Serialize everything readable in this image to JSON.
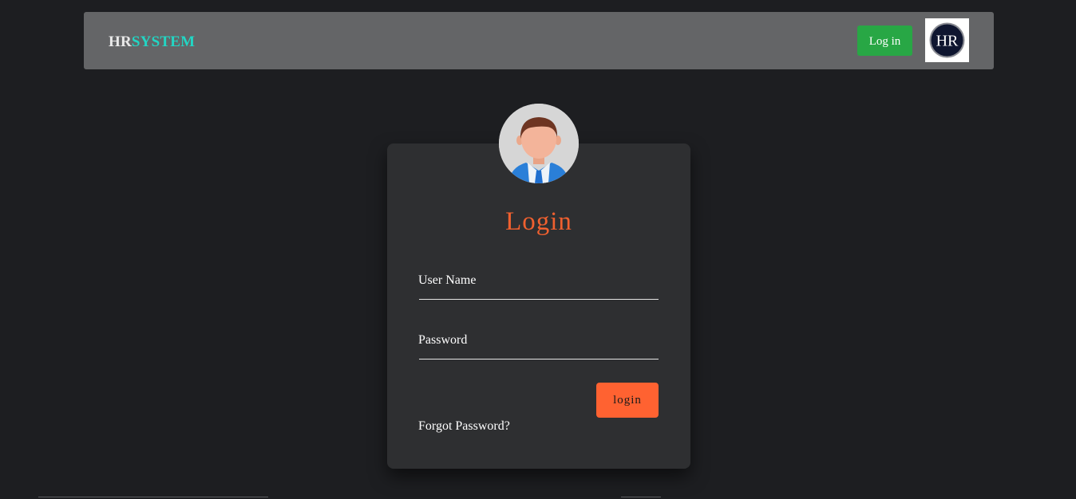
{
  "navbar": {
    "brand_hr": "HR",
    "brand_system": "SYSTEM",
    "login_label": "Log in",
    "logo_text": "HR"
  },
  "login_card": {
    "title": "Login",
    "username": {
      "label": "User Name",
      "value": ""
    },
    "password": {
      "label": "Password",
      "value": ""
    },
    "submit_label": "login",
    "forgot_label": "Forgot Password?"
  },
  "colors": {
    "page_bg": "#1d1e21",
    "navbar_bg": "#646567",
    "brand_accent": "#22d6c4",
    "nav_button": "#28a745",
    "card_bg": "#2e2f31",
    "title": "#f0602f",
    "submit_button": "#ff6231"
  },
  "icons": {
    "avatar": "user-avatar-icon",
    "logo": "hr-logo-icon"
  }
}
